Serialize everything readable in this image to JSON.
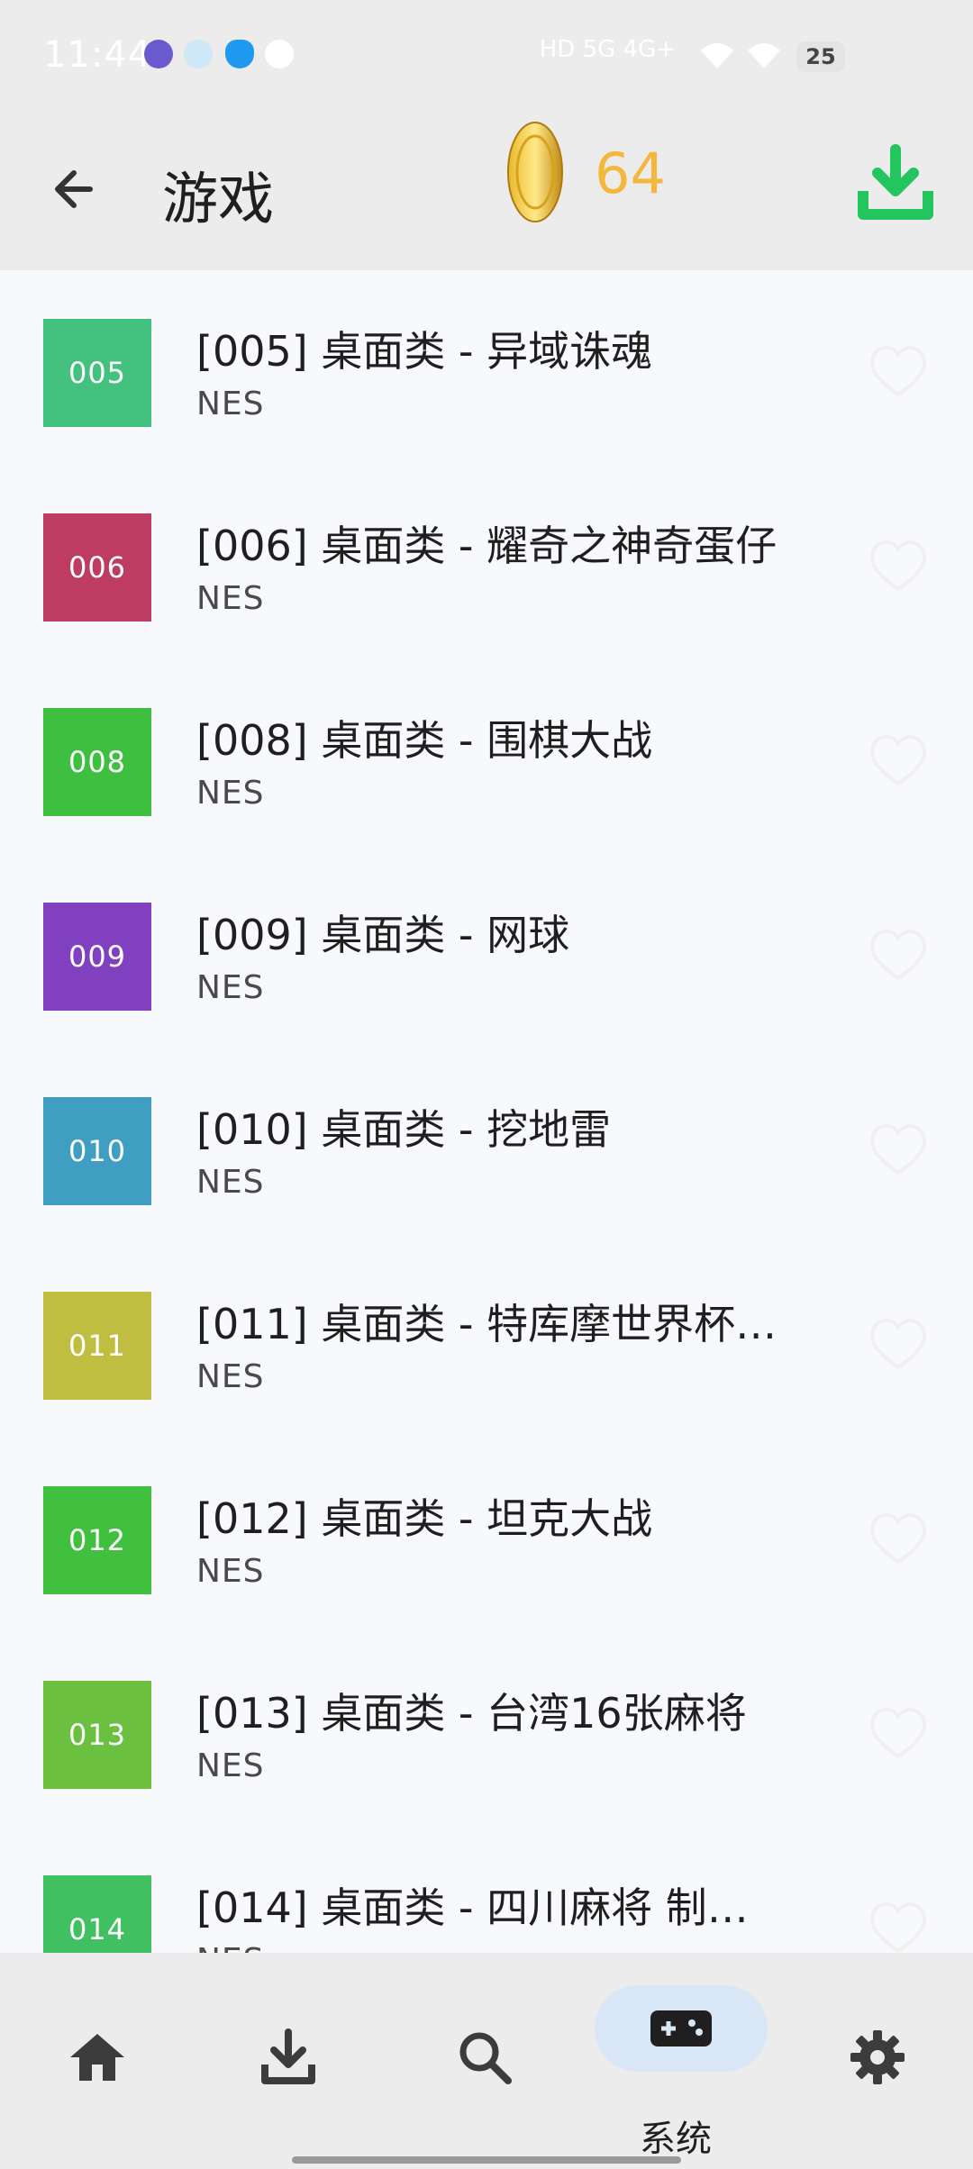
{
  "status_bar": {
    "time": "11:44",
    "network": "HD 5G 4G+",
    "battery": "25"
  },
  "app_bar": {
    "title": "游戏",
    "coin_count": "64",
    "back_icon": "arrow-back-icon",
    "download_icon": "download-icon"
  },
  "games": [
    {
      "code": "005",
      "title": "[005]  桌面类 - 异域诛魂",
      "platform": "NES",
      "color": "#44c07f"
    },
    {
      "code": "006",
      "title": "[006]  桌面类 - 耀奇之神奇蛋仔",
      "platform": "NES",
      "color": "#be3b62"
    },
    {
      "code": "008",
      "title": "[008]  桌面类 - 围棋大战",
      "platform": "NES",
      "color": "#3fbf3f"
    },
    {
      "code": "009",
      "title": "[009]  桌面类 - 网球",
      "platform": "NES",
      "color": "#8040c0"
    },
    {
      "code": "010",
      "title": "[010]  桌面类 - 挖地雷",
      "platform": "NES",
      "color": "#409ec2"
    },
    {
      "code": "011",
      "title": "[011]  桌面类 - 特库摩世界杯…",
      "platform": "NES",
      "color": "#c0be40"
    },
    {
      "code": "012",
      "title": "[012]  桌面类 - 坦克大战",
      "platform": "NES",
      "color": "#41c040"
    },
    {
      "code": "013",
      "title": "[013]  桌面类 - 台湾16张麻将",
      "platform": "NES",
      "color": "#6bc040"
    },
    {
      "code": "014",
      "title": "[014]  桌面类 - 四川麻将 制…",
      "platform": "NES",
      "color": "#40c060"
    }
  ],
  "bottom_nav": {
    "items": [
      {
        "icon": "home-icon",
        "label": ""
      },
      {
        "icon": "download-icon",
        "label": ""
      },
      {
        "icon": "search-icon",
        "label": ""
      },
      {
        "icon": "gamepad-icon",
        "label": "系统",
        "selected": true
      },
      {
        "icon": "settings-icon",
        "label": ""
      }
    ]
  }
}
